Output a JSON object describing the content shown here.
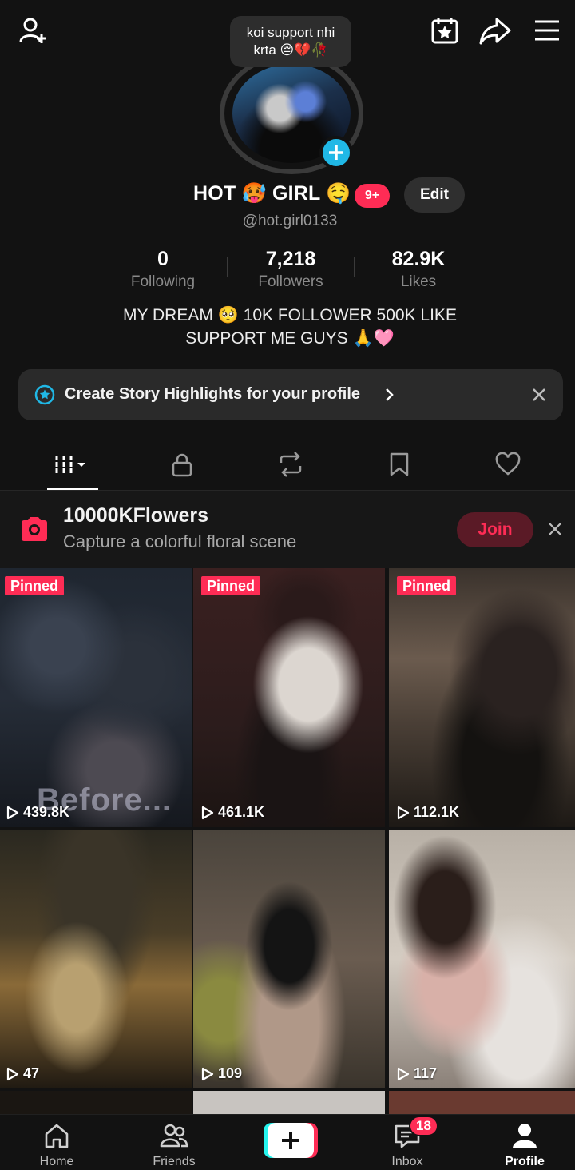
{
  "tooltip": {
    "text": "koi support nhi krta 😔💔🥀"
  },
  "profile": {
    "name": "HOT 🥵 GIRL 🤤",
    "notification_badge": "9+",
    "edit_label": "Edit",
    "username": "@hot.girl0133",
    "bio": "MY DREAM 🥺 10K FOLLOWER 500K LIKE SUPPORT ME GUYS 🙏🩷"
  },
  "stats": [
    {
      "value": "0",
      "label": "Following"
    },
    {
      "value": "7,218",
      "label": "Followers"
    },
    {
      "value": "82.9K",
      "label": "Likes"
    }
  ],
  "highlights": {
    "text": "Create Story Highlights for your profile"
  },
  "tabs": [
    "videos",
    "private",
    "reposts",
    "favorites",
    "liked"
  ],
  "challenge": {
    "title": "10000KFlowers",
    "subtitle": "Capture a colorful floral scene",
    "join_label": "Join"
  },
  "videos": [
    {
      "pinned_label": "Pinned",
      "views": "439.8K",
      "overlay_text": "Before..."
    },
    {
      "pinned_label": "Pinned",
      "views": "461.1K"
    },
    {
      "pinned_label": "Pinned",
      "views": "112.1K"
    },
    {
      "views": "47"
    },
    {
      "views": "109"
    },
    {
      "views": "117"
    }
  ],
  "bottom_nav": {
    "home": "Home",
    "friends": "Friends",
    "inbox": "Inbox",
    "inbox_badge": "18",
    "profile": "Profile"
  },
  "colors": {
    "accent": "#fe2c55",
    "add_button": "#20b8e6",
    "background": "#121212"
  }
}
